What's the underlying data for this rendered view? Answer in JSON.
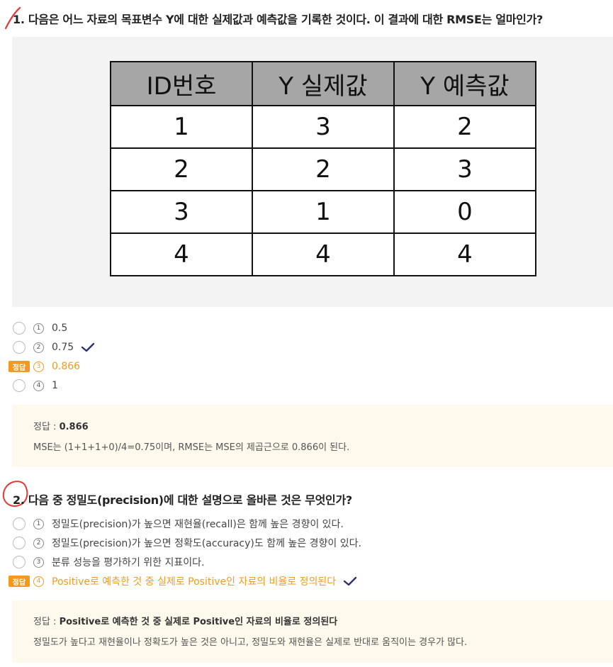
{
  "q1": {
    "title": "1. 다음은 어느 자료의 목표변수 Y에 대한 실제값과 예측값을 기록한 것이다. 이 결과에 대한 RMSE는 얼마인가?",
    "table": {
      "headers": [
        "ID번호",
        "Y 실제값",
        "Y 예측값"
      ],
      "rows": [
        [
          "1",
          "3",
          "2"
        ],
        [
          "2",
          "2",
          "3"
        ],
        [
          "3",
          "1",
          "0"
        ],
        [
          "4",
          "4",
          "4"
        ]
      ]
    },
    "options": [
      {
        "num": "1",
        "text": "0.5"
      },
      {
        "num": "2",
        "text": "0.75"
      },
      {
        "num": "3",
        "text": "0.866"
      },
      {
        "num": "4",
        "text": "1"
      }
    ],
    "answer_badge": "정답",
    "explanation": {
      "label": "정답 : ",
      "answer": "0.866",
      "text": "MSE는 (1+1+1+0)/4=0.75이며, RMSE는 MSE의 제곱근으로 0.866이 된다."
    }
  },
  "q2": {
    "title": "2. 다음 중 정밀도(precision)에 대한 설명으로 올바른 것은 무엇인가?",
    "options": [
      {
        "num": "1",
        "text": "정밀도(precision)가 높으면 재현율(recall)은 함께 높은 경향이 있다."
      },
      {
        "num": "2",
        "text": "정밀도(precision)가 높으면 정확도(accuracy)도 함께 높은 경향이 있다."
      },
      {
        "num": "3",
        "text": "분류 성능을 평가하기 위한 지표이다."
      },
      {
        "num": "4",
        "text": "Positive로 예측한 것 중 실제로 Positive인 자료의 비율로 정의된다"
      }
    ],
    "answer_badge": "정답",
    "explanation": {
      "label": "정답 : ",
      "answer": "Positive로 예측한 것 중 실제로 Positive인 자료의 비율로 정의된다",
      "text": "정밀도가 높다고 재현율이나 정확도가 높은 것은 아니고, 정밀도와 재현율은 실제로 반대로 움직이는 경우가 많다."
    }
  },
  "colors": {
    "accent": "#f39a1e",
    "check": "#2b3170",
    "mark": "#e53935",
    "explanation_bg": "#fff8ec",
    "figure_bg": "#f3f3f3"
  }
}
